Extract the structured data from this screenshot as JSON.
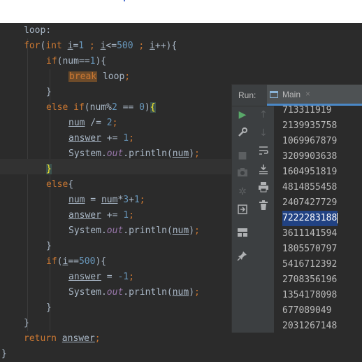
{
  "code": {
    "label": "loop",
    "for_keyword": "for",
    "int_keyword": "int",
    "loop_var": "i",
    "loop_start": "1",
    "loop_limit": "500",
    "if_keyword": "if",
    "num_var": "num",
    "one": "1",
    "break_keyword": "break",
    "else_keyword": "else",
    "two": "2",
    "zero": "0",
    "answer_var": "answer",
    "system": "System",
    "out_field": "out",
    "println": "println",
    "three": "3",
    "neg_one": "-1",
    "return_keyword": "return"
  },
  "run_panel": {
    "label": "Run:",
    "tab_name": "Main",
    "tab_close": "×",
    "output_lines": [
      "713311919",
      "2139935758",
      "1069967879",
      "3209903638",
      "1604951819",
      "4814855458",
      "2407427729",
      "7222283188",
      "3611141594",
      "1805570797",
      "5416712392",
      "2708356196",
      "1354178098",
      "677089049",
      "2031267148"
    ],
    "selected_index": 7
  },
  "icons": {
    "run": "run-icon",
    "wrench": "wrench-icon",
    "stop": "stop-icon",
    "camera": "camera-icon",
    "gear": "gear-icon",
    "login": "restore-layout-icon",
    "layout": "layout-icon",
    "pin": "pin-icon",
    "up": "arrow-up-icon",
    "down": "arrow-down-icon",
    "wrap": "soft-wrap-icon",
    "scroll_end": "scroll-to-end-icon",
    "print": "print-icon",
    "trash": "trash-icon"
  },
  "colors": {
    "keyword": "#cc7832",
    "number": "#6897bb",
    "field": "#9876aa",
    "text": "#a9b7c6",
    "selection": "#214283",
    "run_green": "#59a869"
  }
}
